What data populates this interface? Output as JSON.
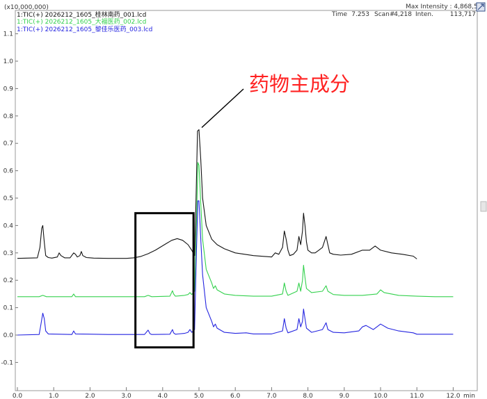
{
  "header": {
    "scale_label": "(x10,000,000)",
    "max_intensity": "Max Intensity : 4,868,5",
    "time_label": "Time",
    "time_value": "7.253",
    "scan_label": "Scan#",
    "scan_value": "4,218",
    "inten_label": "Inten.",
    "inten_value": "113,717"
  },
  "annotation": {
    "text": "药物主成分",
    "points_to": 5.0
  },
  "highlight_box": {
    "x_range": [
      3.25,
      4.85
    ],
    "y_range": [
      -0.045,
      0.445
    ]
  },
  "chart_data": {
    "type": "line",
    "xlabel": "min",
    "xlim": [
      0.0,
      12.0
    ],
    "ylim": [
      -0.12,
      1.12
    ],
    "xticks": [
      0.0,
      1.0,
      2.0,
      3.0,
      4.0,
      5.0,
      6.0,
      7.0,
      8.0,
      9.0,
      10.0,
      11.0,
      12.0
    ],
    "xtick_labels": [
      "0.0",
      "1.0",
      "2.0",
      "3.0",
      "4.0",
      "5.0",
      "6.0",
      "7.0",
      "8.0",
      "9.0",
      "10.0",
      "11.0",
      "12.0"
    ],
    "yticks": [
      -0.1,
      0.0,
      0.1,
      0.2,
      0.3,
      0.4,
      0.5,
      0.6,
      0.7,
      0.8,
      0.9,
      1.0,
      1.1
    ],
    "ytick_labels": [
      "-0.1",
      "0.0",
      "0.1",
      "0.2",
      "0.3",
      "0.4",
      "0.5",
      "0.6",
      "0.7",
      "0.8",
      "0.9",
      "1.0",
      "1.1"
    ],
    "series": [
      {
        "name": "1:TIC(+) 2026212_1605_桂林南药_001.lcd",
        "color": "#111111",
        "x": [
          0.0,
          0.55,
          0.62,
          0.67,
          0.7,
          0.74,
          0.78,
          0.85,
          0.95,
          1.1,
          1.15,
          1.2,
          1.3,
          1.45,
          1.55,
          1.6,
          1.65,
          1.72,
          1.76,
          1.8,
          1.9,
          2.1,
          2.5,
          3.0,
          3.2,
          3.4,
          3.6,
          3.8,
          3.95,
          4.1,
          4.25,
          4.4,
          4.55,
          4.7,
          4.8,
          4.88,
          4.92,
          4.96,
          5.0,
          5.05,
          5.1,
          5.2,
          5.35,
          5.5,
          5.7,
          6.0,
          6.5,
          7.0,
          7.1,
          7.2,
          7.3,
          7.35,
          7.4,
          7.45,
          7.5,
          7.6,
          7.7,
          7.75,
          7.8,
          7.85,
          7.88,
          7.92,
          7.96,
          8.0,
          8.1,
          8.2,
          8.3,
          8.4,
          8.5,
          8.55,
          8.6,
          8.7,
          8.9,
          9.2,
          9.5,
          9.7,
          9.85,
          10.0,
          10.3,
          10.6,
          10.9,
          11.0
        ],
        "y": [
          0.28,
          0.282,
          0.32,
          0.39,
          0.4,
          0.34,
          0.29,
          0.283,
          0.281,
          0.285,
          0.3,
          0.29,
          0.282,
          0.282,
          0.3,
          0.295,
          0.285,
          0.29,
          0.305,
          0.29,
          0.283,
          0.281,
          0.28,
          0.28,
          0.282,
          0.287,
          0.297,
          0.31,
          0.322,
          0.334,
          0.346,
          0.352,
          0.346,
          0.33,
          0.31,
          0.29,
          0.5,
          0.745,
          0.75,
          0.64,
          0.5,
          0.4,
          0.35,
          0.33,
          0.315,
          0.3,
          0.29,
          0.285,
          0.3,
          0.295,
          0.32,
          0.38,
          0.35,
          0.31,
          0.29,
          0.295,
          0.31,
          0.36,
          0.33,
          0.38,
          0.445,
          0.4,
          0.34,
          0.31,
          0.3,
          0.3,
          0.31,
          0.32,
          0.36,
          0.33,
          0.3,
          0.295,
          0.292,
          0.295,
          0.31,
          0.31,
          0.325,
          0.31,
          0.3,
          0.295,
          0.288,
          0.278
        ]
      },
      {
        "name": "1:TIC(+) 2026212_1605_大福医药_002.lcd",
        "color": "#33d14d",
        "x": [
          0.0,
          0.6,
          0.7,
          0.8,
          1.5,
          1.55,
          1.6,
          2.5,
          3.5,
          3.6,
          3.7,
          4.2,
          4.27,
          4.3,
          4.35,
          4.6,
          4.7,
          4.75,
          4.8,
          4.88,
          4.93,
          4.97,
          5.0,
          5.05,
          5.1,
          5.2,
          5.35,
          5.4,
          5.45,
          5.5,
          5.7,
          6.0,
          6.5,
          7.0,
          7.3,
          7.35,
          7.4,
          7.45,
          7.7,
          7.75,
          7.8,
          7.85,
          7.88,
          7.92,
          7.96,
          8.1,
          8.4,
          8.5,
          8.55,
          8.7,
          9.0,
          9.5,
          9.9,
          10.0,
          10.1,
          10.5,
          11.0,
          11.5,
          12.0
        ],
        "y": [
          0.14,
          0.14,
          0.145,
          0.14,
          0.14,
          0.15,
          0.14,
          0.14,
          0.14,
          0.145,
          0.14,
          0.142,
          0.162,
          0.15,
          0.142,
          0.145,
          0.148,
          0.155,
          0.148,
          0.16,
          0.4,
          0.63,
          0.62,
          0.48,
          0.35,
          0.24,
          0.19,
          0.17,
          0.18,
          0.165,
          0.15,
          0.145,
          0.142,
          0.142,
          0.15,
          0.19,
          0.16,
          0.145,
          0.16,
          0.19,
          0.16,
          0.2,
          0.255,
          0.21,
          0.17,
          0.155,
          0.16,
          0.18,
          0.16,
          0.148,
          0.145,
          0.145,
          0.15,
          0.165,
          0.155,
          0.145,
          0.142,
          0.14,
          0.14
        ]
      },
      {
        "name": "1:TIC(+) 2026212_1605_黎佳乐医药_003.lcd",
        "color": "#2424e0",
        "x": [
          0.0,
          0.6,
          0.65,
          0.7,
          0.74,
          0.78,
          0.85,
          1.5,
          1.55,
          1.6,
          2.5,
          3.5,
          3.6,
          3.65,
          3.7,
          4.2,
          4.27,
          4.3,
          4.35,
          4.6,
          4.7,
          4.75,
          4.8,
          4.88,
          4.93,
          4.97,
          5.0,
          5.05,
          5.1,
          5.2,
          5.35,
          5.4,
          5.45,
          5.5,
          5.7,
          6.0,
          6.3,
          6.5,
          7.0,
          7.3,
          7.35,
          7.4,
          7.45,
          7.7,
          7.75,
          7.8,
          7.85,
          7.88,
          7.92,
          7.96,
          8.1,
          8.4,
          8.5,
          8.55,
          8.7,
          9.0,
          9.4,
          9.5,
          9.6,
          9.8,
          9.9,
          10.0,
          10.2,
          10.5,
          10.9,
          11.0,
          12.0
        ],
        "y": [
          0.0,
          0.002,
          0.04,
          0.08,
          0.06,
          0.015,
          0.004,
          0.002,
          0.015,
          0.004,
          0.002,
          0.002,
          0.018,
          0.005,
          0.002,
          0.003,
          0.02,
          0.008,
          0.003,
          0.006,
          0.01,
          0.02,
          0.01,
          0.02,
          0.3,
          0.49,
          0.49,
          0.35,
          0.22,
          0.1,
          0.05,
          0.03,
          0.04,
          0.025,
          0.01,
          0.006,
          0.008,
          0.004,
          0.004,
          0.015,
          0.06,
          0.025,
          0.008,
          0.02,
          0.06,
          0.03,
          0.05,
          0.095,
          0.06,
          0.025,
          0.01,
          0.02,
          0.045,
          0.02,
          0.01,
          0.008,
          0.015,
          0.03,
          0.035,
          0.02,
          0.03,
          0.04,
          0.025,
          0.015,
          0.008,
          0.003,
          0.003
        ]
      }
    ]
  }
}
